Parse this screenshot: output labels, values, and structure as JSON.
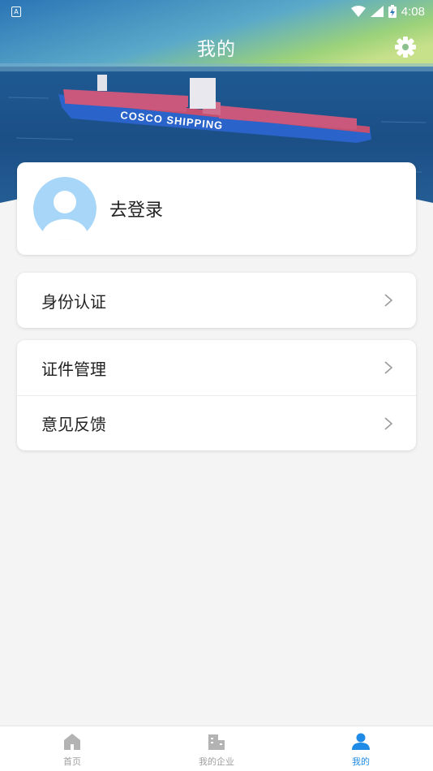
{
  "status_bar": {
    "app_badge": "A",
    "time": "4:08"
  },
  "header": {
    "title": "我的"
  },
  "login_card": {
    "login_text": "去登录"
  },
  "menu": {
    "identity_label": "身份认证",
    "certificates_label": "证件管理",
    "feedback_label": "意见反馈"
  },
  "bottom_nav": {
    "items": [
      {
        "label": "首页",
        "icon": "home-icon"
      },
      {
        "label": "我的企业",
        "icon": "enterprise-icon"
      },
      {
        "label": "我的",
        "icon": "user-icon",
        "active": true
      }
    ]
  },
  "colors": {
    "accent": "#1e8be6",
    "inactive": "#a0a0a0",
    "background": "#f4f4f4"
  }
}
